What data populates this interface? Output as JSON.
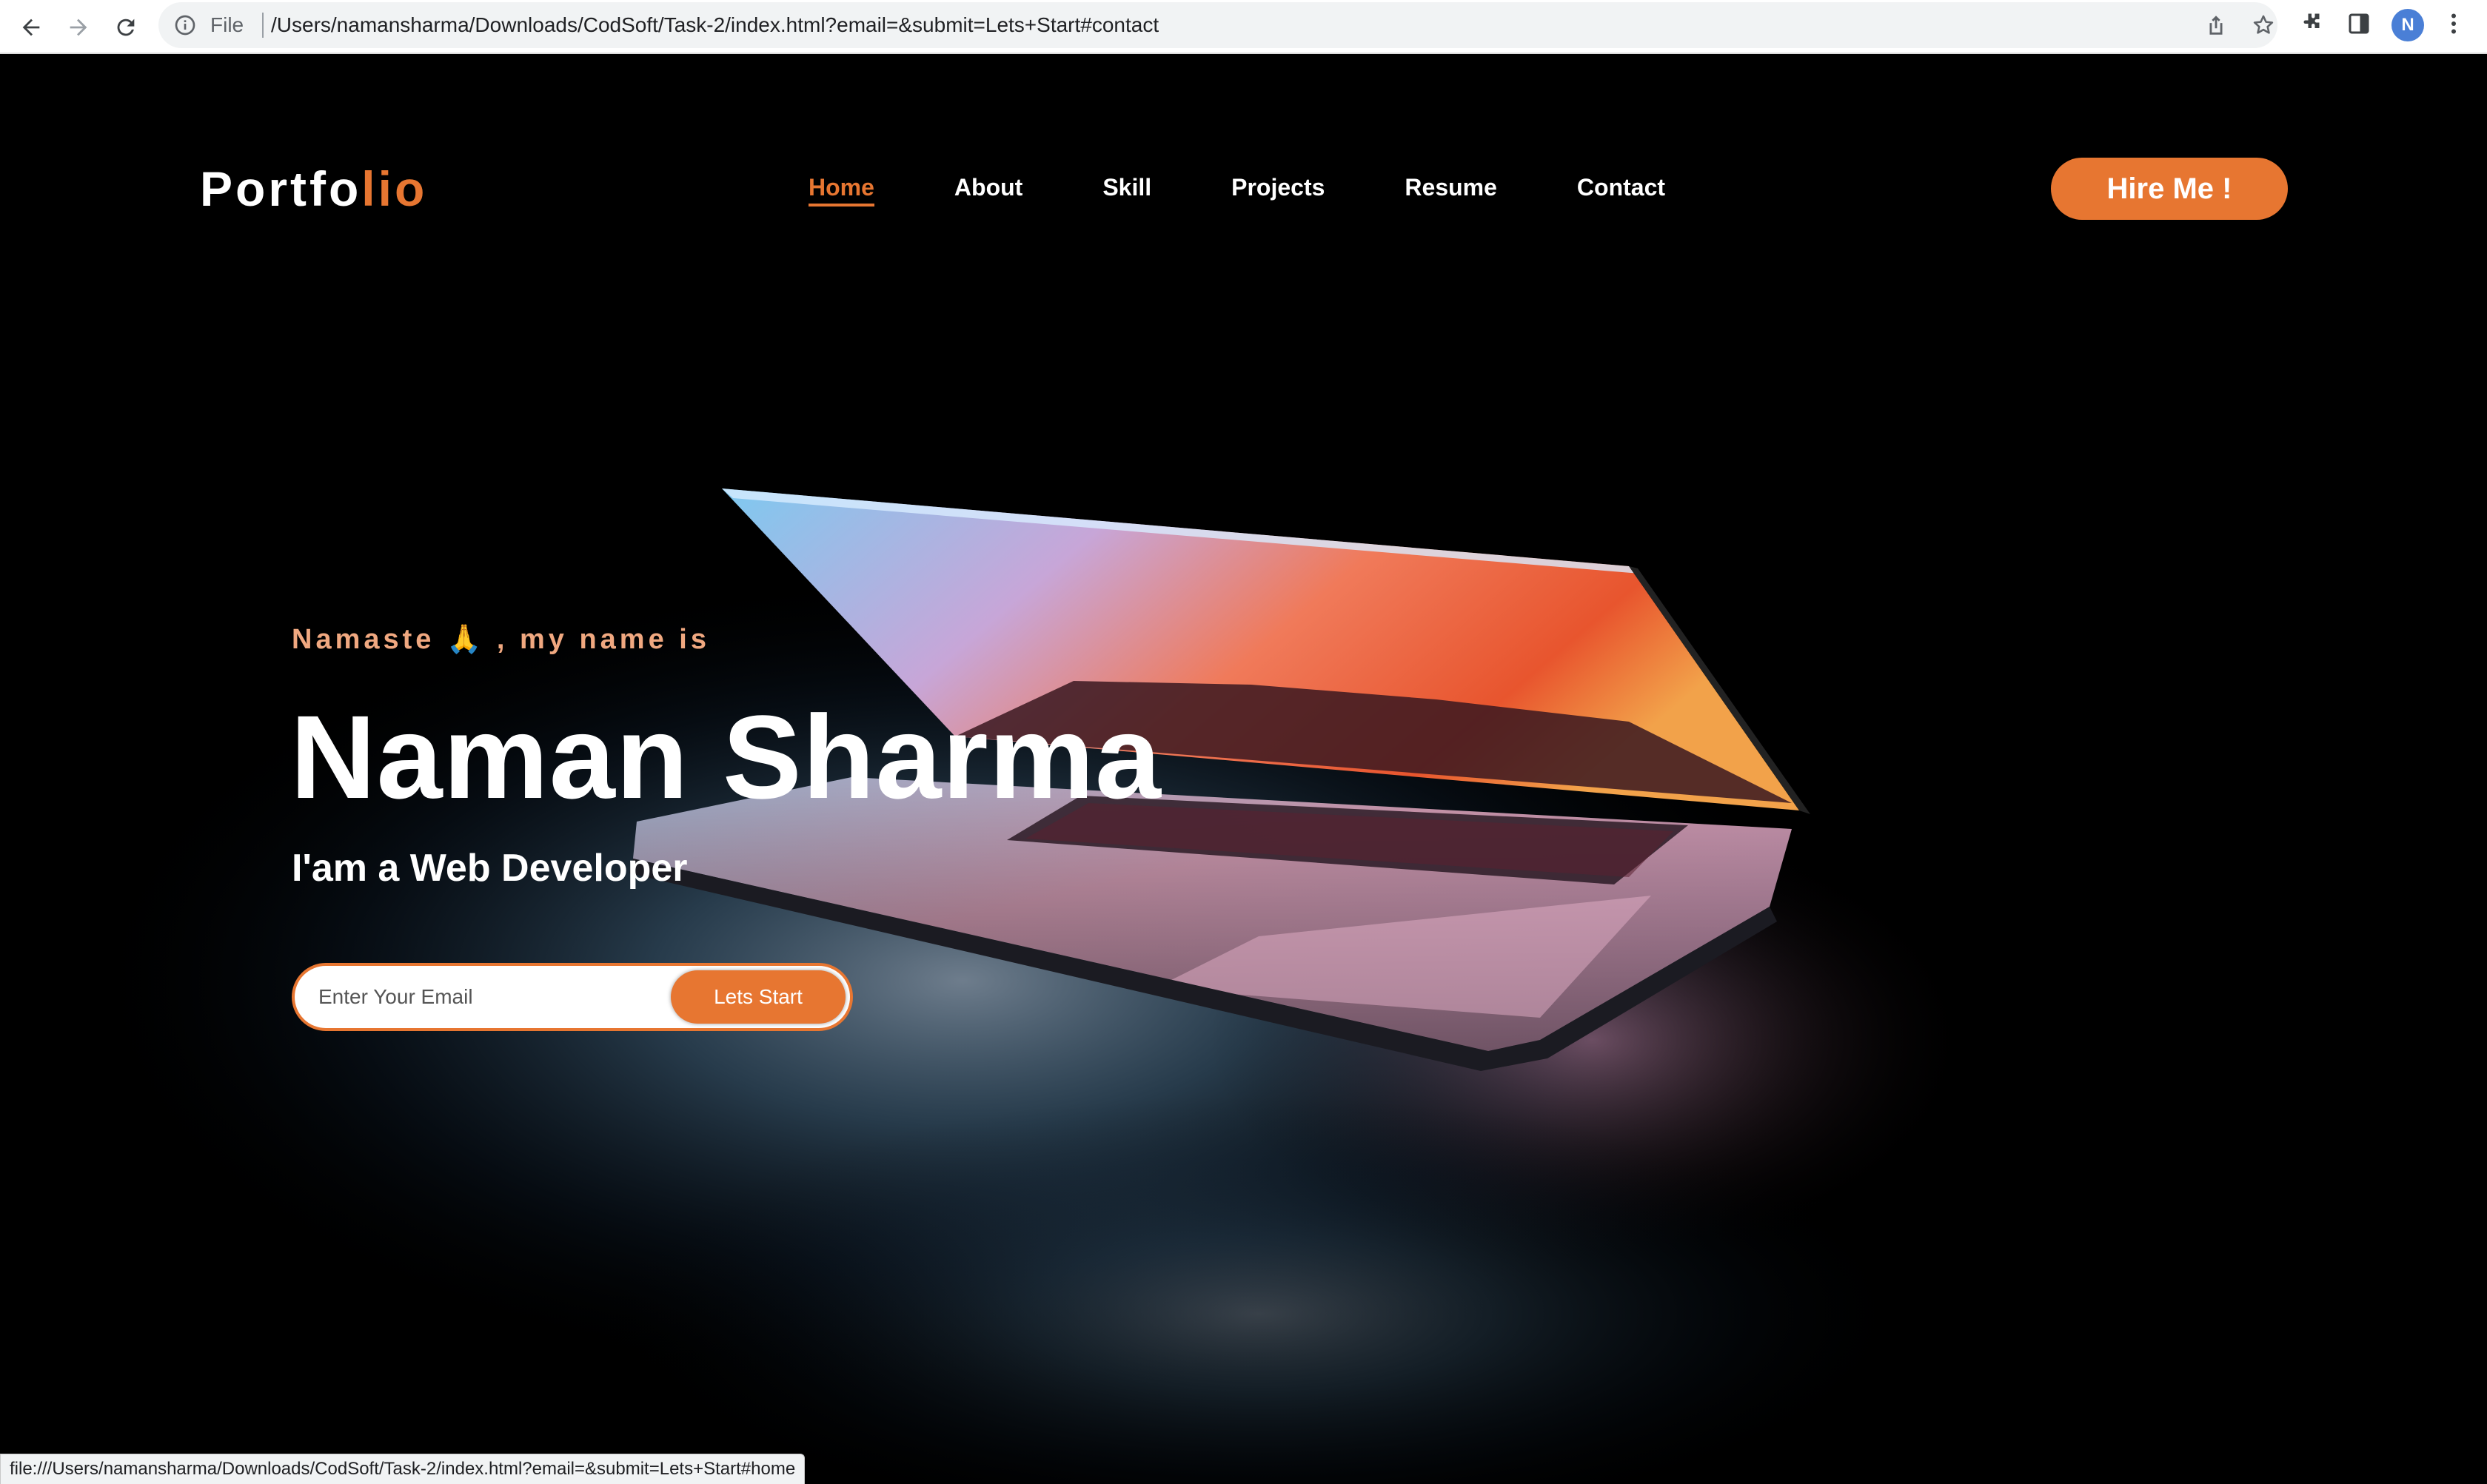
{
  "browser": {
    "file_label": "File",
    "url": "/Users/namansharma/Downloads/CodSoft/Task-2/index.html?email=&submit=Lets+Start#contact",
    "avatar_letter": "N",
    "status_url": "file:///Users/namansharma/Downloads/CodSoft/Task-2/index.html?email=&submit=Lets+Start#home"
  },
  "header": {
    "logo_main": "Portfo",
    "logo_accent": "lio",
    "nav": [
      {
        "label": "Home",
        "active": true
      },
      {
        "label": "About",
        "active": false
      },
      {
        "label": "Skill",
        "active": false
      },
      {
        "label": "Projects",
        "active": false
      },
      {
        "label": "Resume",
        "active": false
      },
      {
        "label": "Contact",
        "active": false
      }
    ],
    "hire_label": "Hire Me !"
  },
  "hero": {
    "greeting": "Namaste 🙏 , my name is",
    "name": "Naman Sharma",
    "role": "I'am a Web Developer",
    "email_placeholder": "Enter Your Email",
    "submit_label": "Lets Start"
  },
  "colors": {
    "accent": "#e77631",
    "greeting": "#f0a880",
    "background": "#000000"
  }
}
